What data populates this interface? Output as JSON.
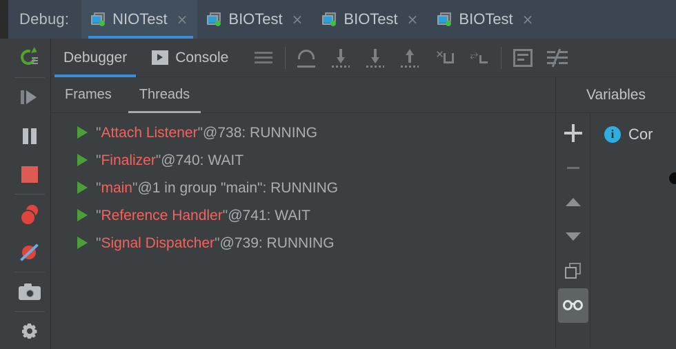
{
  "window": {
    "debug_label": "Debug:",
    "accent_blue": "#3d8bdb",
    "thread_name_color": "#f2635c",
    "run_green": "#4d9f3a",
    "stop_red": "#dd5b52"
  },
  "tabs": [
    {
      "title": "NIOTest",
      "close": "×",
      "icon": "run-configuration-icon",
      "active": true
    },
    {
      "title": "BIOTest",
      "close": "×",
      "icon": "run-configuration-icon",
      "active": false
    },
    {
      "title": "BIOTest",
      "close": "×",
      "icon": "run-configuration-icon",
      "active": false
    },
    {
      "title": "BIOTest",
      "close": "×",
      "icon": "run-configuration-icon",
      "active": false
    }
  ],
  "sidebar": {
    "items": [
      {
        "name": "rerun-button",
        "icon": "rerun-icon"
      },
      {
        "name": "resume-program-button",
        "icon": "resume-icon"
      },
      {
        "name": "pause-program-button",
        "icon": "pause-icon"
      },
      {
        "name": "stop-button",
        "icon": "stop-icon"
      },
      {
        "name": "view-breakpoints-button",
        "icon": "breakpoints-icon"
      },
      {
        "name": "mute-breakpoints-button",
        "icon": "mute-breakpoints-icon"
      },
      {
        "name": "get-thread-dump-button",
        "icon": "camera-icon"
      },
      {
        "name": "settings-button",
        "icon": "gear-icon"
      }
    ]
  },
  "tool_tabs": [
    {
      "label": "Debugger",
      "active": true,
      "icon": null
    },
    {
      "label": "Console",
      "active": false,
      "icon": "console-icon"
    }
  ],
  "tool_icons": [
    {
      "name": "layout-settings-icon",
      "kind": "lines"
    },
    {
      "name": "step-over-icon",
      "kind": "step-over"
    },
    {
      "name": "step-into-icon",
      "kind": "step-into"
    },
    {
      "name": "force-step-into-icon",
      "kind": "force-step-into"
    },
    {
      "name": "step-out-icon",
      "kind": "step-out"
    },
    {
      "name": "drop-frame-icon",
      "kind": "drop-frame"
    },
    {
      "name": "run-to-cursor-icon",
      "kind": "run-to-cursor"
    },
    {
      "name": "evaluate-expression-icon",
      "kind": "evaluate"
    },
    {
      "name": "settings-filter-icon",
      "kind": "filter"
    }
  ],
  "sub_tabs": [
    {
      "label": "Frames",
      "active": false
    },
    {
      "label": "Threads",
      "active": true
    }
  ],
  "variables_panel": {
    "title": "Variables",
    "toolbar": [
      {
        "name": "add-watch-button",
        "icon": "plus-icon",
        "selected": false
      },
      {
        "name": "remove-watch-button",
        "icon": "minus-icon",
        "selected": false
      },
      {
        "name": "move-watch-up-button",
        "icon": "arrow-up-icon",
        "selected": false
      },
      {
        "name": "move-watch-down-button",
        "icon": "arrow-down-icon",
        "selected": false
      },
      {
        "name": "copy-value-button",
        "icon": "copy-icon",
        "selected": false
      },
      {
        "name": "toggle-watch-button",
        "icon": "glasses-icon",
        "selected": true
      }
    ],
    "rows": [
      {
        "icon": "info-icon",
        "icon_glyph": "i",
        "text": "Cor"
      }
    ]
  },
  "threads": [
    {
      "quote_open": "\"",
      "name": "Attach Listener",
      "quote_close": "\"",
      "rest": "@738: RUNNING",
      "state": "RUNNING",
      "id": "738"
    },
    {
      "quote_open": "\"",
      "name": "Finalizer",
      "quote_close": "\"",
      "rest": "@740: WAIT",
      "state": "WAIT",
      "id": "740"
    },
    {
      "quote_open": "\"",
      "name": "main",
      "quote_close": "\"",
      "rest": "@1 in group \"main\": RUNNING",
      "state": "RUNNING",
      "id": "1"
    },
    {
      "quote_open": "\"",
      "name": "Reference Handler",
      "quote_close": "\"",
      "rest": "@741: WAIT",
      "state": "WAIT",
      "id": "741"
    },
    {
      "quote_open": "\"",
      "name": "Signal Dispatcher",
      "quote_close": "\"",
      "rest": "@739: RUNNING",
      "state": "RUNNING",
      "id": "739"
    }
  ]
}
